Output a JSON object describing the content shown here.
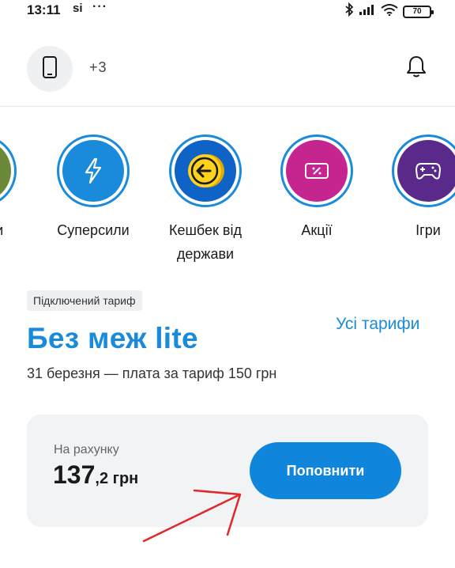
{
  "status_bar": {
    "time": "13:11",
    "app_indicator": "si",
    "more": "···",
    "battery": "70"
  },
  "header": {
    "phone_number": "+3                       "
  },
  "stories": [
    {
      "label": "…жити",
      "icon": "partial-icon",
      "color": "#6a8a3a"
    },
    {
      "label": "Суперсили",
      "icon": "lightning-icon",
      "color": "#1a8bdb"
    },
    {
      "label": "Кешбек від держави",
      "icon": "coin-cashback-icon",
      "color": "#0f62c6"
    },
    {
      "label": "Акції",
      "icon": "ticket-icon",
      "color": "#c4258f"
    },
    {
      "label": "Ігри",
      "icon": "gamepad-icon",
      "color": "#5a2a8a"
    }
  ],
  "tariff": {
    "tag": "Підключений тариф",
    "all_tariffs": "Усі тарифи",
    "name": "Без меж lite",
    "info": "31 березня — плата за тариф 150 грн"
  },
  "balance": {
    "label": "На рахунку",
    "integer": "137",
    "fraction": ",2 грн",
    "topup_button": "Поповнити"
  },
  "colors": {
    "accent": "#1a8bdb",
    "button": "#0f86dc",
    "card_bg": "#f1f3f5",
    "annotation": "#e0282a"
  }
}
